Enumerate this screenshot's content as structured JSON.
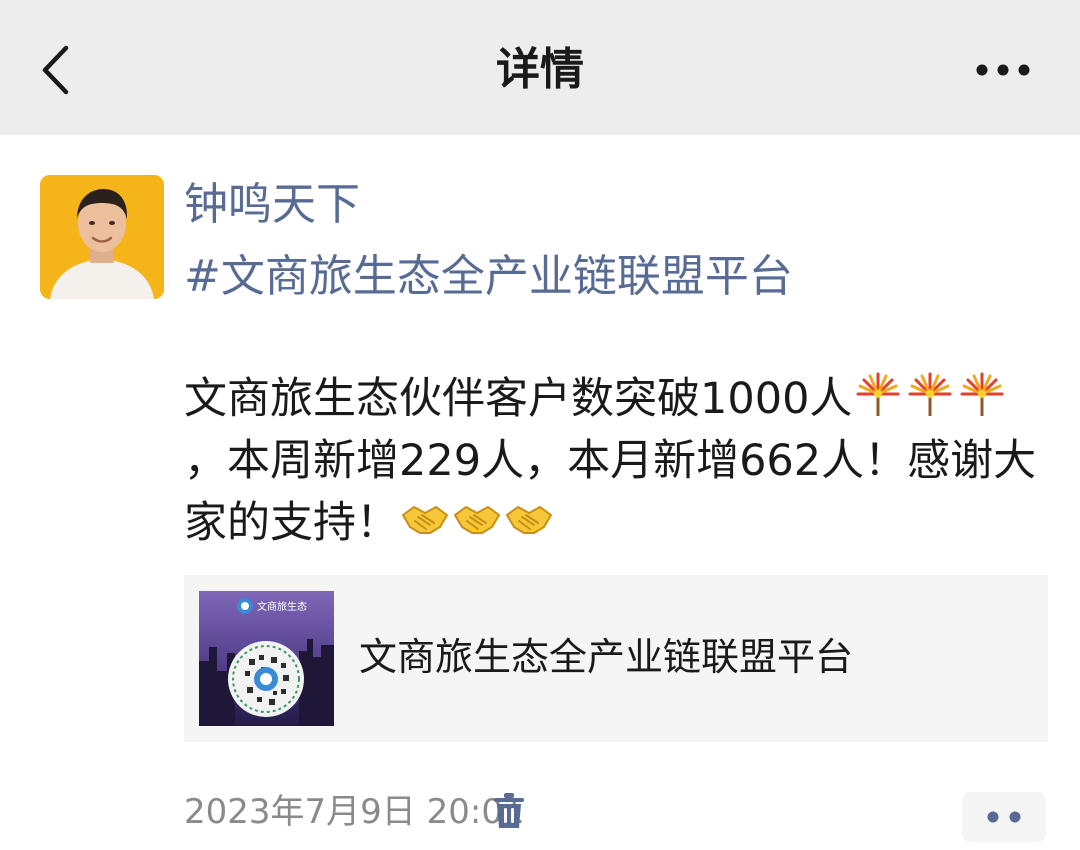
{
  "nav": {
    "title": "详情",
    "back_icon": "chevron-left-icon",
    "more_icon": "more-dots-icon"
  },
  "post": {
    "author": "钟鸣天下",
    "topic": "#文商旅生态全产业链联盟平台",
    "body_parts": [
      "文商旅生态伙伴客户数突破1000人",
      "，本周新增229人，本月新增662人！感谢大家的支持！"
    ],
    "emojis": [
      "fireworks-emoji",
      "fireworks-emoji",
      "fireworks-emoji",
      "handshake-emoji",
      "handshake-emoji",
      "handshake-emoji"
    ],
    "link_card": {
      "title": "文商旅生态全产业链联盟平台",
      "thumb_brand": "文商旅生态"
    },
    "timestamp": "2023年7月9日 20:01",
    "delete_icon": "trash-icon",
    "comment_icon": "comment-dots-icon"
  },
  "colors": {
    "nav_bg": "#ededed",
    "link_blue": "#576b95",
    "card_bg": "#f5f5f5",
    "avatar_bg": "#f4b41a"
  }
}
